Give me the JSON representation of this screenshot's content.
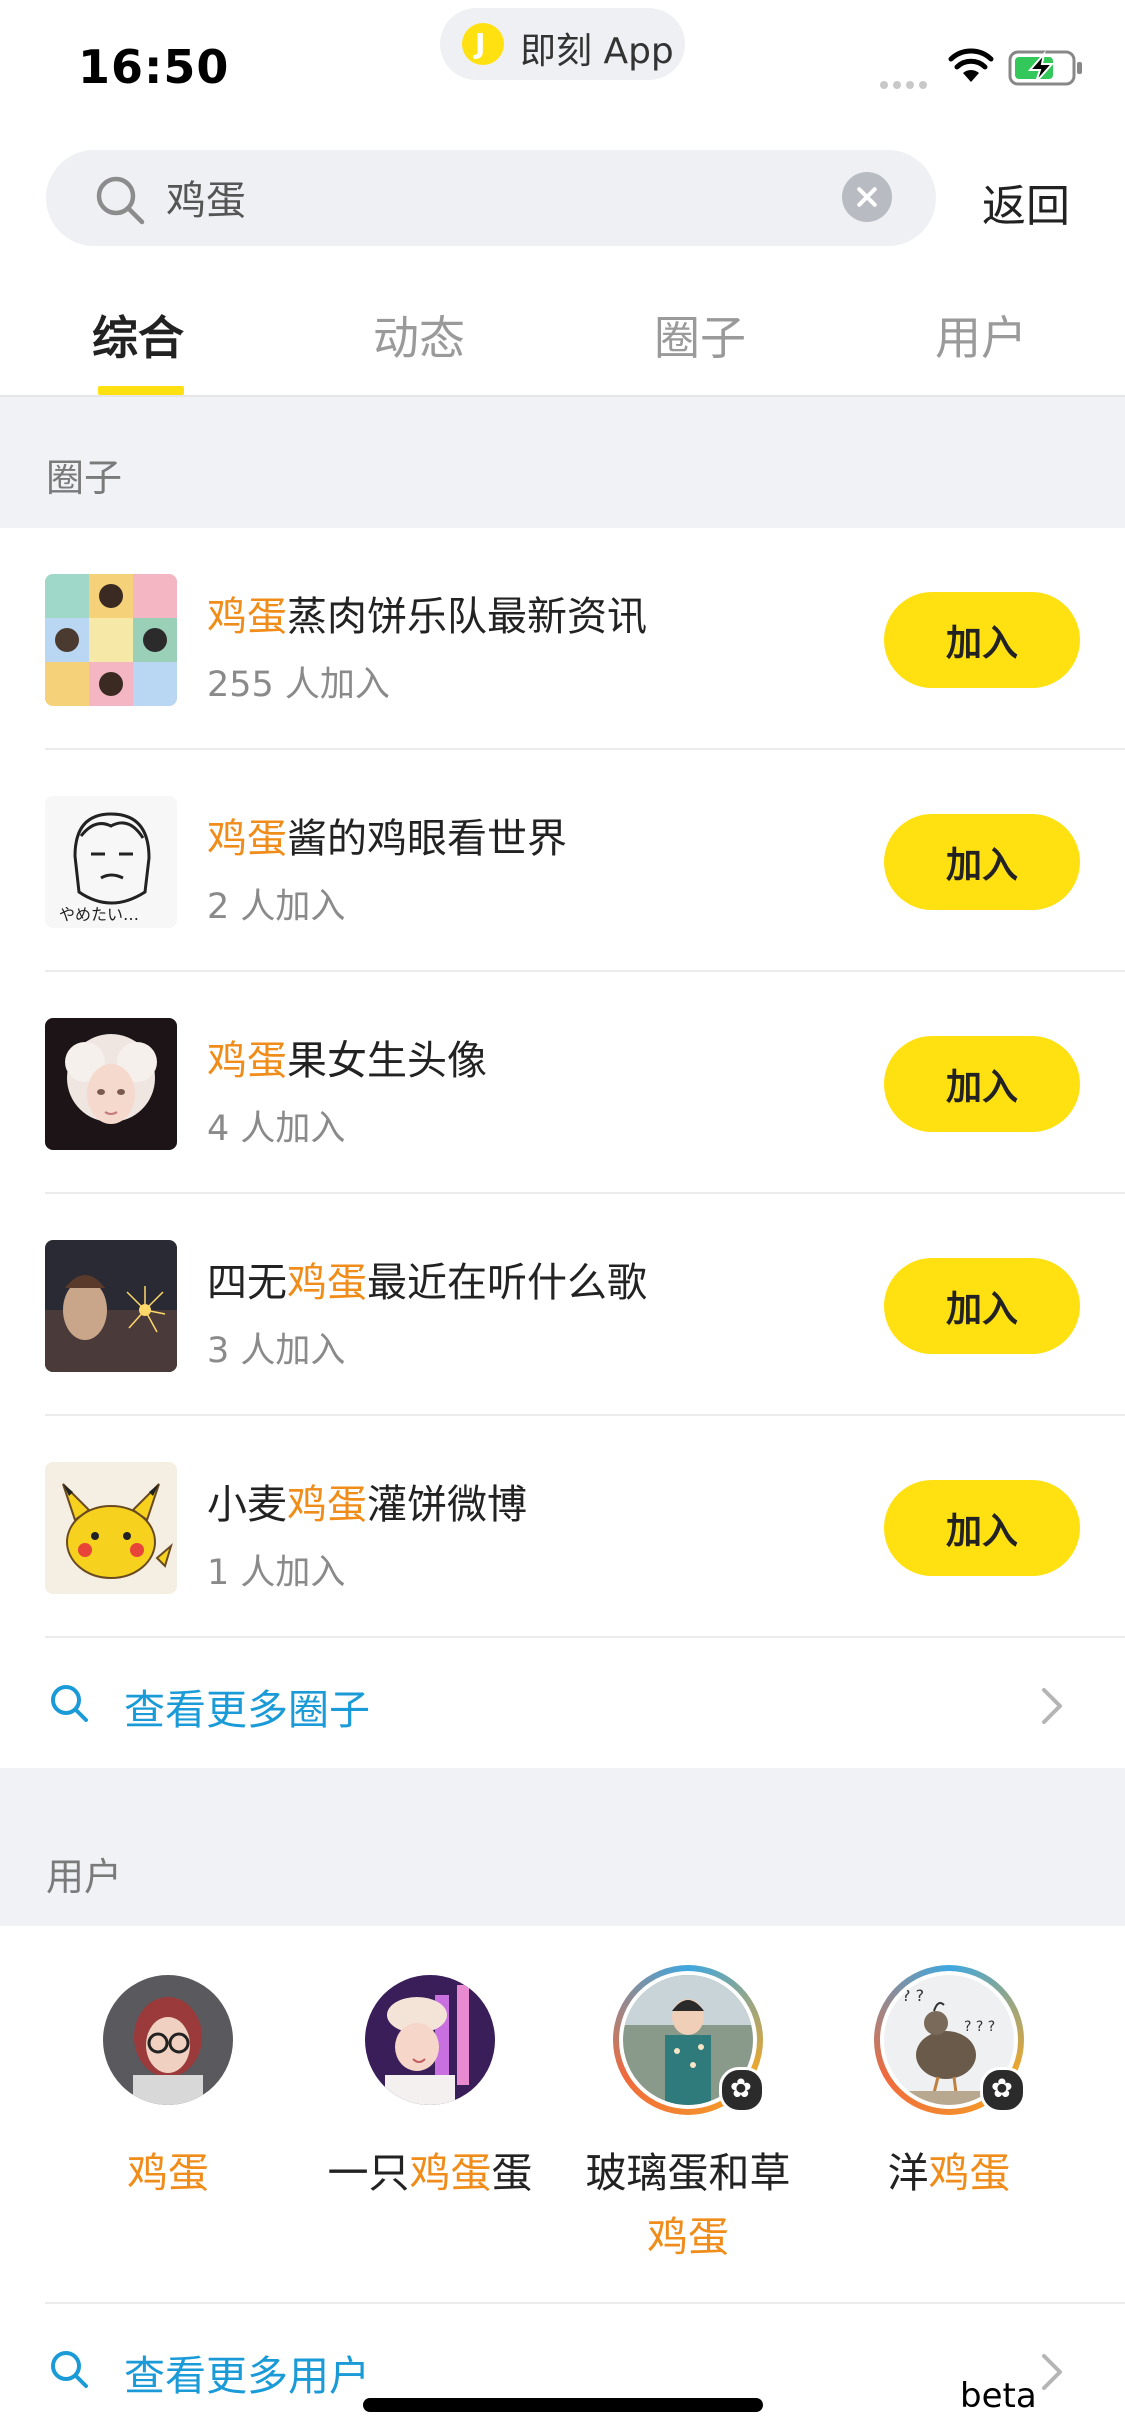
{
  "status_bar": {
    "time": "16:50",
    "app_pill": "即刻 App"
  },
  "search": {
    "query": "鸡蛋",
    "back_label": "返回"
  },
  "tabs": [
    {
      "label": "综合",
      "active": true
    },
    {
      "label": "动态",
      "active": false
    },
    {
      "label": "圈子",
      "active": false
    },
    {
      "label": "用户",
      "active": false
    }
  ],
  "circles_section": {
    "title": "圈子",
    "items": [
      {
        "pre": "",
        "hl": "鸡蛋",
        "post": "蒸肉饼乐队最新资讯",
        "count": "255 人加入",
        "join_label": "加入"
      },
      {
        "pre": "",
        "hl": "鸡蛋",
        "post": "酱的鸡眼看世界",
        "count": "2 人加入",
        "join_label": "加入"
      },
      {
        "pre": "",
        "hl": "鸡蛋",
        "post": "果女生头像",
        "count": "4 人加入",
        "join_label": "加入"
      },
      {
        "pre": "四无",
        "hl": "鸡蛋",
        "post": "最近在听什么歌",
        "count": "3 人加入",
        "join_label": "加入"
      },
      {
        "pre": "小麦",
        "hl": "鸡蛋",
        "post": "灌饼微博",
        "count": "1 人加入",
        "join_label": "加入"
      }
    ],
    "more_label": "查看更多圈子"
  },
  "users_section": {
    "title": "用户",
    "items": [
      {
        "pre": "",
        "hl": "鸡蛋",
        "post": "",
        "line2": ""
      },
      {
        "pre": "一只",
        "hl": "鸡蛋",
        "post": "蛋",
        "line2": ""
      },
      {
        "pre": "玻璃蛋和草",
        "hl": "",
        "post": "",
        "line2": "鸡蛋"
      },
      {
        "pre": "洋",
        "hl": "鸡蛋",
        "post": "",
        "line2": ""
      }
    ],
    "more_label": "查看更多用户"
  },
  "beta_label": "beta",
  "colors": {
    "accent_yellow": "#ffe111",
    "highlight_orange": "#f08c1a",
    "link_blue": "#1a9bd7"
  }
}
